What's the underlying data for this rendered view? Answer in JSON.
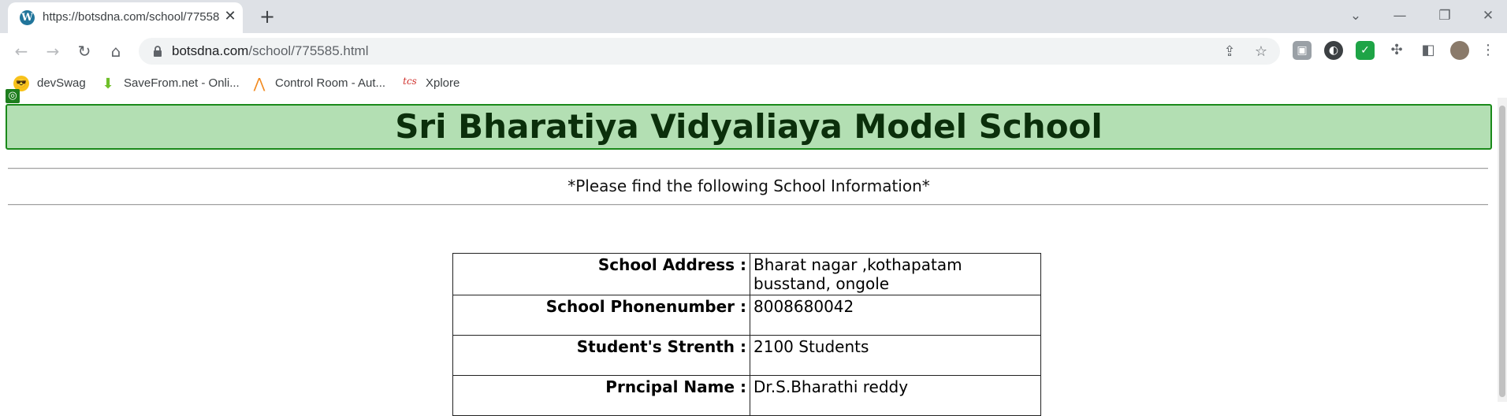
{
  "browser": {
    "tab_title": "https://botsdna.com/school/775585.html",
    "tab_close": "✕",
    "new_tab": "+",
    "url_host": "botsdna.com",
    "url_path": "/school/775585.html",
    "window_controls": {
      "collapse": "⌄",
      "minimize": "—",
      "restore": "❐",
      "close": "✕"
    },
    "nav_icons": {
      "back": "←",
      "forward": "→",
      "reload": "↻",
      "home": "⌂"
    },
    "bookmarks": [
      {
        "label": "devSwag",
        "icon": "sunglasses-emoji-icon"
      },
      {
        "label": "SaveFrom.net - Onli...",
        "icon": "download-arrow-icon"
      },
      {
        "label": "Control Room - Aut...",
        "icon": "automation-anywhere-icon"
      },
      {
        "label": "Xplore",
        "icon": "tcs-icon"
      }
    ],
    "colors": {
      "tabstrip": "#dee1e6",
      "omnibox": "#f1f3f4"
    }
  },
  "page": {
    "banner_title": "Sri Bharatiya Vidyaliaya Model School",
    "notice": "*Please find the following School Information*",
    "rows": [
      {
        "label": "School Address :",
        "value": "Bharat nagar ,kothapatam busstand, ongole"
      },
      {
        "label": "School Phonenumber :",
        "value": "8008680042"
      },
      {
        "label": "Student's Strenth :",
        "value": "2100 Students"
      },
      {
        "label": "Prncipal Name :",
        "value": "Dr.S.Bharathi reddy"
      }
    ],
    "colors": {
      "banner_bg": "#b3dfb3",
      "banner_border": "#1a8a1a",
      "banner_text": "#0b2f0b"
    }
  }
}
